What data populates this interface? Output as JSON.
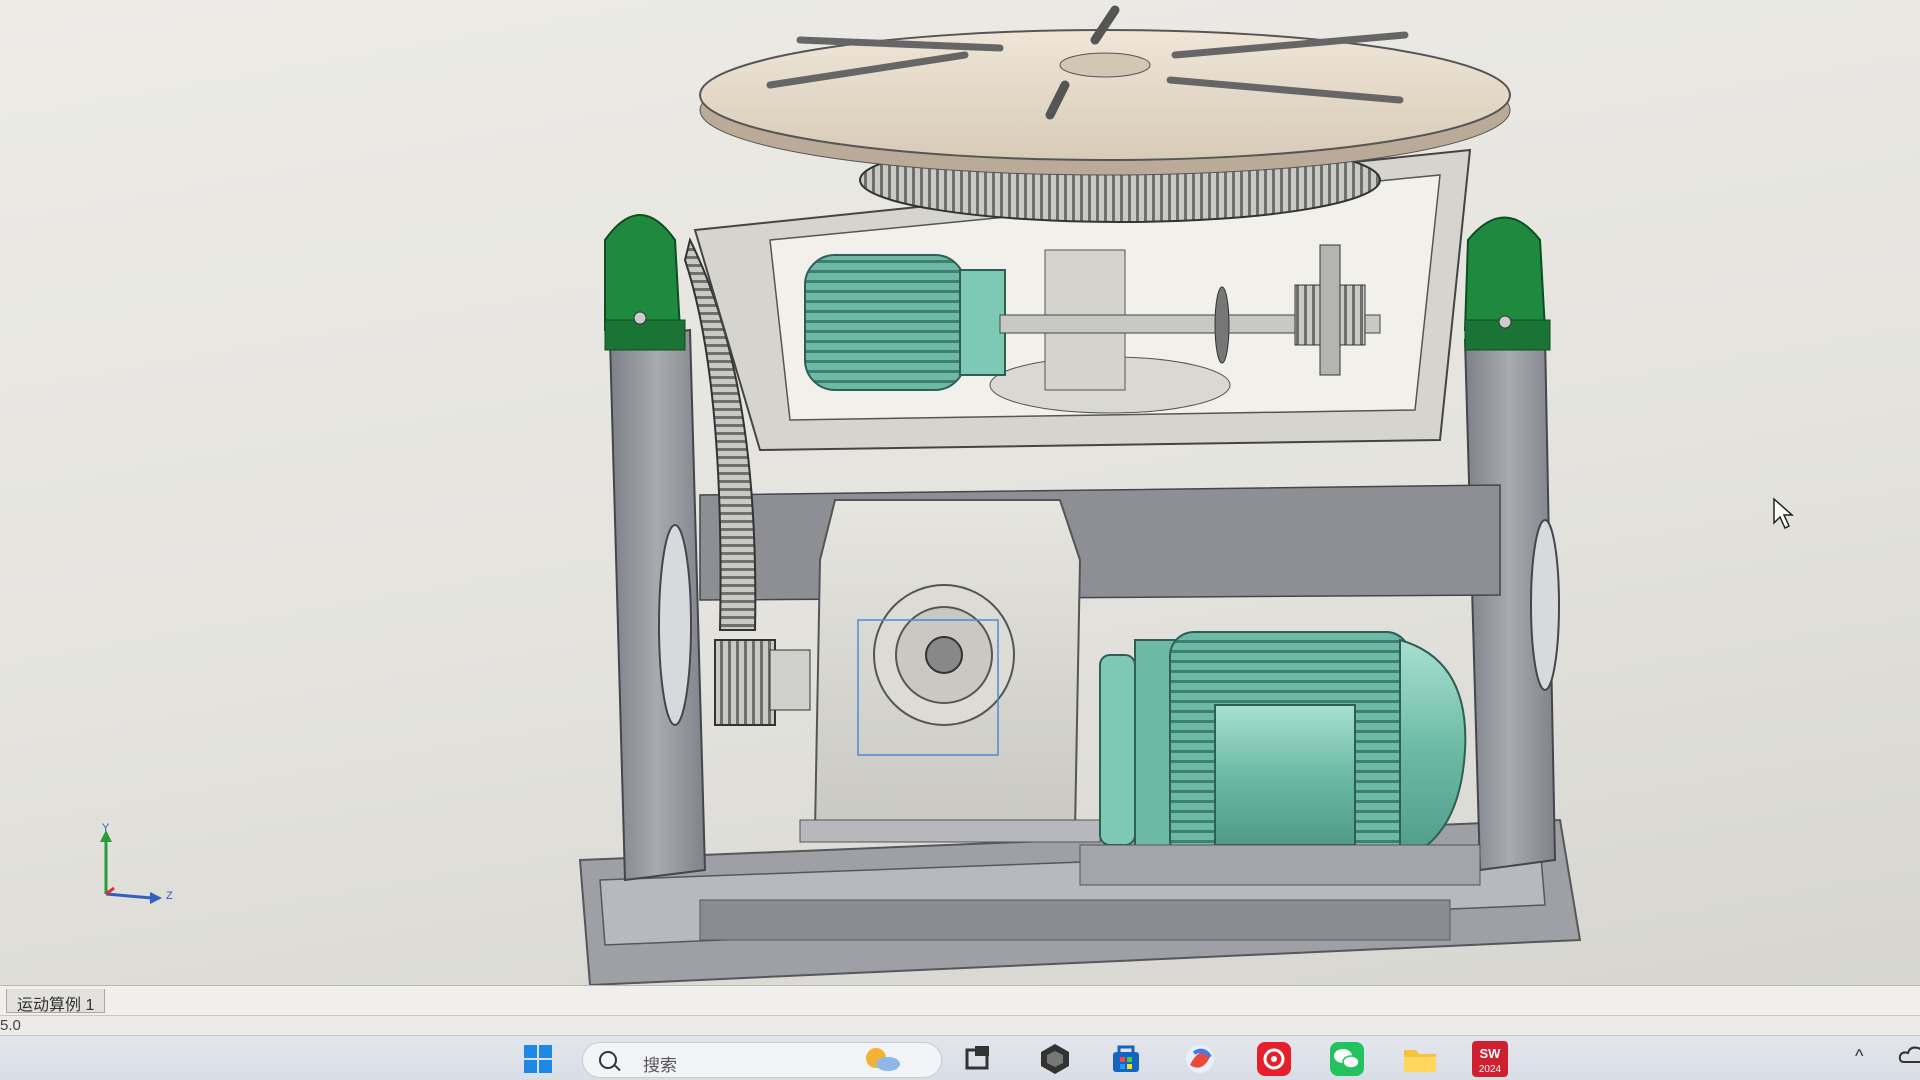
{
  "viewport": {
    "background": "#e8e7e2",
    "model_description_colors": {
      "frame": "#8e9097",
      "frame_light": "#b5b7bd",
      "housing": "#d9d8d2",
      "motor": "#7ec9b5",
      "bearing_block": "#1f8a3e",
      "turntable": "#e5d9c8",
      "gear": "#9a9a9a"
    },
    "triad": {
      "y_label": "Y",
      "z_label": "Z"
    }
  },
  "motion_study": {
    "tab_label": "运动算例 1"
  },
  "status_bar": {
    "value": "5.0"
  },
  "taskbar": {
    "search_placeholder": "搜索",
    "items": [
      {
        "name": "windows-start-icon"
      },
      {
        "name": "search-box"
      },
      {
        "name": "weather-widget-icon"
      },
      {
        "name": "task-view-icon"
      },
      {
        "name": "app-hexagon-icon"
      },
      {
        "name": "microsoft-store-icon"
      },
      {
        "name": "media-player-icon"
      },
      {
        "name": "netease-music-icon"
      },
      {
        "name": "wechat-icon"
      },
      {
        "name": "file-explorer-icon"
      },
      {
        "name": "solidworks-2024-icon"
      }
    ],
    "solidworks_badge": "2024",
    "tray_chevron": "^"
  }
}
